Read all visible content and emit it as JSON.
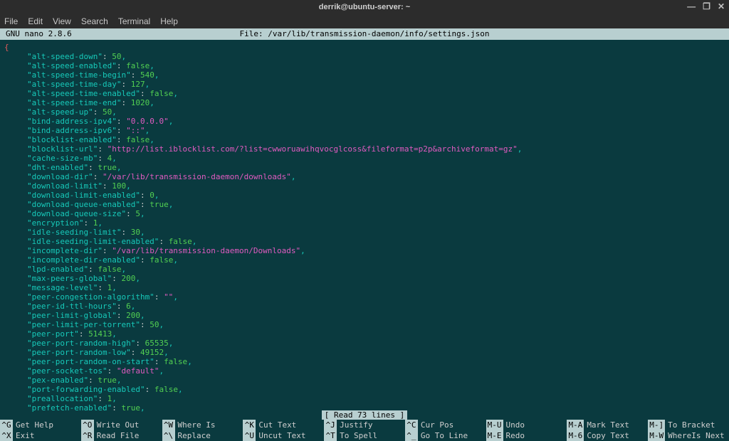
{
  "window": {
    "title": "derrik@ubuntu-server: ~"
  },
  "menubar": [
    "File",
    "Edit",
    "View",
    "Search",
    "Terminal",
    "Help"
  ],
  "nano": {
    "version": "GNU nano 2.8.6",
    "file_label": "File: /var/lib/transmission-daemon/info/settings.json",
    "status": "[ Read 73 lines ]"
  },
  "json_lines": [
    {
      "k": "alt-speed-down",
      "t": "num",
      "v": "50"
    },
    {
      "k": "alt-speed-enabled",
      "t": "bool",
      "v": "false"
    },
    {
      "k": "alt-speed-time-begin",
      "t": "num",
      "v": "540"
    },
    {
      "k": "alt-speed-time-day",
      "t": "num",
      "v": "127"
    },
    {
      "k": "alt-speed-time-enabled",
      "t": "bool",
      "v": "false"
    },
    {
      "k": "alt-speed-time-end",
      "t": "num",
      "v": "1020"
    },
    {
      "k": "alt-speed-up",
      "t": "num",
      "v": "50"
    },
    {
      "k": "bind-address-ipv4",
      "t": "str",
      "v": "\"0.0.0.0\""
    },
    {
      "k": "bind-address-ipv6",
      "t": "str",
      "v": "\"::\""
    },
    {
      "k": "blocklist-enabled",
      "t": "bool",
      "v": "false"
    },
    {
      "k": "blocklist-url",
      "t": "str",
      "v": "\"http://list.iblocklist.com/?list=cwworuawihqvocglcoss&fileformat=p2p&archiveformat=gz\""
    },
    {
      "k": "cache-size-mb",
      "t": "num",
      "v": "4"
    },
    {
      "k": "dht-enabled",
      "t": "bool",
      "v": "true"
    },
    {
      "k": "download-dir",
      "t": "str",
      "v": "\"/var/lib/transmission-daemon/downloads\""
    },
    {
      "k": "download-limit",
      "t": "num",
      "v": "100"
    },
    {
      "k": "download-limit-enabled",
      "t": "num",
      "v": "0"
    },
    {
      "k": "download-queue-enabled",
      "t": "bool",
      "v": "true"
    },
    {
      "k": "download-queue-size",
      "t": "num",
      "v": "5"
    },
    {
      "k": "encryption",
      "t": "num",
      "v": "1"
    },
    {
      "k": "idle-seeding-limit",
      "t": "num",
      "v": "30"
    },
    {
      "k": "idle-seeding-limit-enabled",
      "t": "bool",
      "v": "false"
    },
    {
      "k": "incomplete-dir",
      "t": "str",
      "v": "\"/var/lib/transmission-daemon/Downloads\""
    },
    {
      "k": "incomplete-dir-enabled",
      "t": "bool",
      "v": "false"
    },
    {
      "k": "lpd-enabled",
      "t": "bool",
      "v": "false"
    },
    {
      "k": "max-peers-global",
      "t": "num",
      "v": "200"
    },
    {
      "k": "message-level",
      "t": "num",
      "v": "1"
    },
    {
      "k": "peer-congestion-algorithm",
      "t": "str",
      "v": "\"\""
    },
    {
      "k": "peer-id-ttl-hours",
      "t": "num",
      "v": "6"
    },
    {
      "k": "peer-limit-global",
      "t": "num",
      "v": "200"
    },
    {
      "k": "peer-limit-per-torrent",
      "t": "num",
      "v": "50"
    },
    {
      "k": "peer-port",
      "t": "num",
      "v": "51413"
    },
    {
      "k": "peer-port-random-high",
      "t": "num",
      "v": "65535"
    },
    {
      "k": "peer-port-random-low",
      "t": "num",
      "v": "49152"
    },
    {
      "k": "peer-port-random-on-start",
      "t": "bool",
      "v": "false"
    },
    {
      "k": "peer-socket-tos",
      "t": "str",
      "v": "\"default\""
    },
    {
      "k": "pex-enabled",
      "t": "bool",
      "v": "true"
    },
    {
      "k": "port-forwarding-enabled",
      "t": "bool",
      "v": "false"
    },
    {
      "k": "preallocation",
      "t": "num",
      "v": "1"
    },
    {
      "k": "prefetch-enabled",
      "t": "bool",
      "v": "true"
    }
  ],
  "shortcuts_row1": [
    {
      "key": "^G",
      "label": "Get Help"
    },
    {
      "key": "^O",
      "label": "Write Out"
    },
    {
      "key": "^W",
      "label": "Where Is"
    },
    {
      "key": "^K",
      "label": "Cut Text"
    },
    {
      "key": "^J",
      "label": "Justify"
    },
    {
      "key": "^C",
      "label": "Cur Pos"
    },
    {
      "key": "M-U",
      "label": "Undo"
    },
    {
      "key": "M-A",
      "label": "Mark Text"
    },
    {
      "key": "M-]",
      "label": "To Bracket"
    }
  ],
  "shortcuts_row2": [
    {
      "key": "^X",
      "label": "Exit"
    },
    {
      "key": "^R",
      "label": "Read File"
    },
    {
      "key": "^\\",
      "label": "Replace"
    },
    {
      "key": "^U",
      "label": "Uncut Text"
    },
    {
      "key": "^T",
      "label": "To Spell"
    },
    {
      "key": "^_",
      "label": "Go To Line"
    },
    {
      "key": "M-E",
      "label": "Redo"
    },
    {
      "key": "M-6",
      "label": "Copy Text"
    },
    {
      "key": "M-W",
      "label": "WhereIs Next"
    }
  ]
}
